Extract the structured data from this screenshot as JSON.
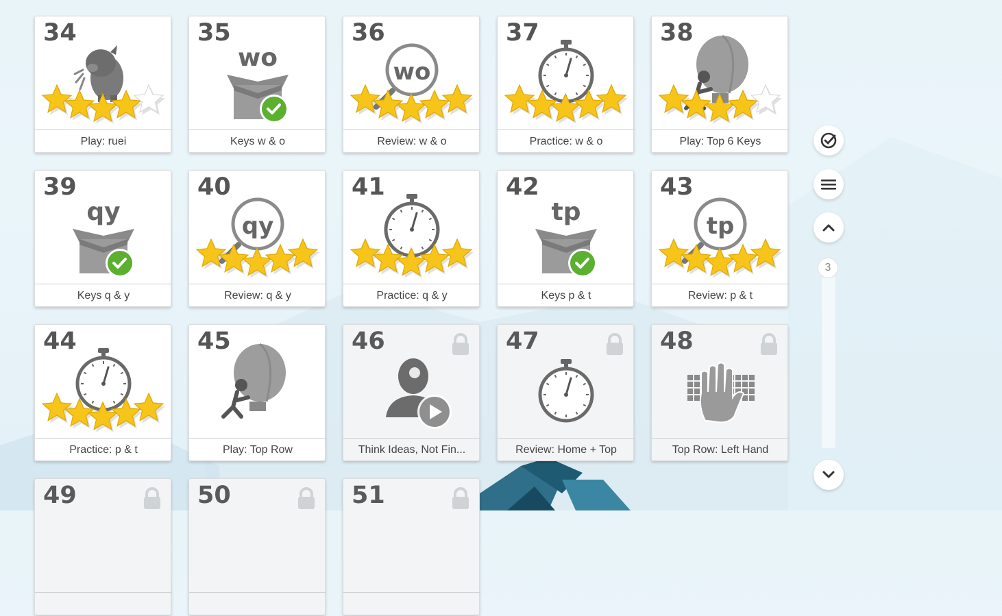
{
  "lessons": [
    {
      "num": "34",
      "label": "Play: ruei",
      "icon": "dragon-game-icon",
      "stars": 4,
      "locked": false
    },
    {
      "num": "35",
      "label": "Keys w & o",
      "icon": "new-keys-box-icon",
      "keys": "wo",
      "done": true,
      "locked": false
    },
    {
      "num": "36",
      "label": "Review: w & o",
      "icon": "review-magnifier-icon",
      "keys": "wo",
      "stars": 5,
      "locked": false
    },
    {
      "num": "37",
      "label": "Practice: w & o",
      "icon": "stopwatch-icon",
      "stars": 5,
      "locked": false
    },
    {
      "num": "38",
      "label": "Play: Top 6 Keys",
      "icon": "balloon-game-icon",
      "stars": 4,
      "locked": false
    },
    {
      "num": "39",
      "label": "Keys q & y",
      "icon": "new-keys-box-icon",
      "keys": "qy",
      "done": true,
      "locked": false
    },
    {
      "num": "40",
      "label": "Review: q & y",
      "icon": "review-magnifier-icon",
      "keys": "qy",
      "stars": 5,
      "locked": false
    },
    {
      "num": "41",
      "label": "Practice: q & y",
      "icon": "stopwatch-icon",
      "stars": 5,
      "locked": false
    },
    {
      "num": "42",
      "label": "Keys p & t",
      "icon": "new-keys-box-icon",
      "keys": "tp",
      "done": true,
      "locked": false
    },
    {
      "num": "43",
      "label": "Review: p & t",
      "icon": "review-magnifier-icon",
      "keys": "tp",
      "stars": 5,
      "locked": false
    },
    {
      "num": "44",
      "label": "Practice: p & t",
      "icon": "stopwatch-icon",
      "stars": 5,
      "locked": false
    },
    {
      "num": "45",
      "label": "Play: Top Row",
      "icon": "balloon-game-icon",
      "stars": 0,
      "locked": false
    },
    {
      "num": "46",
      "label": "Think Ideas, Not Fin...",
      "icon": "video-lesson-icon",
      "locked": true
    },
    {
      "num": "47",
      "label": "Review: Home + Top",
      "icon": "stopwatch-icon",
      "locked": true
    },
    {
      "num": "48",
      "label": "Top Row: Left Hand",
      "icon": "keyboard-hand-icon",
      "locked": true
    },
    {
      "num": "49",
      "label": "",
      "icon": "",
      "locked": true
    },
    {
      "num": "50",
      "label": "",
      "icon": "",
      "locked": true
    },
    {
      "num": "51",
      "label": "",
      "icon": "",
      "locked": true
    }
  ],
  "sidebar": {
    "check_icon": "check-circle-icon",
    "menu_icon": "hamburger-menu-icon",
    "up_icon": "chevron-up-icon",
    "page": "3",
    "down_icon": "chevron-down-icon"
  },
  "colors": {
    "star": "#f7c51a",
    "check": "#5bb02f",
    "icon_gray": "#6e6e6e"
  }
}
